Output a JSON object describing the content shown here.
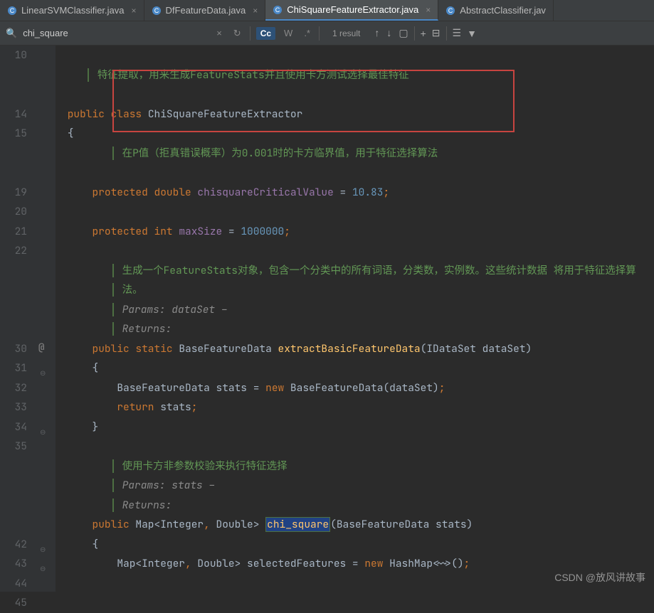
{
  "tabs": [
    {
      "name": "LinearSVMClassifier.java",
      "active": false,
      "icon": "#4a88c7"
    },
    {
      "name": "DfFeatureData.java",
      "active": false,
      "icon": "#4a88c7"
    },
    {
      "name": "ChiSquareFeatureExtractor.java",
      "active": true,
      "icon": "#4a88c7"
    },
    {
      "name": "AbstractClassifier.jav",
      "active": false,
      "icon": "#4a88c7"
    }
  ],
  "search": {
    "value": "chi_square",
    "cc": "Cc",
    "w": "W",
    "result": "1 result"
  },
  "lines": {
    "10": "10",
    "14": "14",
    "15": "15",
    "19": "19",
    "20": "20",
    "21": "21",
    "22": "22",
    "30": "30",
    "31": "31",
    "32": "32",
    "33": "33",
    "34": "34",
    "35": "35",
    "42": "42",
    "43": "43",
    "44": "44",
    "45": "45"
  },
  "code": {
    "cmt1": "特征提取，用来生成FeatureStats并且使用卡方测试选择最佳特征",
    "l14a": "public",
    "l14b": "class",
    "l14c": "ChiSquareFeatureExtractor",
    "l15": "{",
    "cmt2": "在P值（拒真错误概率）为0.001时的卡方临界值，用于特征选择算法",
    "l19a": "protected",
    "l19b": "double",
    "l19c": "chisquareCriticalValue",
    "l19d": " = ",
    "l19e": "10.83",
    "l19f": ";",
    "l21a": "protected",
    "l21b": "int",
    "l21c": "maxSize",
    "l21d": " = ",
    "l21e": "1000000",
    "l21f": ";",
    "cmt3a": "生成一个FeatureStats对象，包含一个分类中的所有词语，分类数，实例数。这些统计数据 将用于特征选择算",
    "cmt3b": "法。",
    "params": "Params: ",
    "dataset": "dataSet – ",
    "returns": "Returns:",
    "l30a": "public",
    "l30b": "static",
    "l30c": "BaseFeatureData",
    "l30d": "extractBasicFeatureData",
    "l30e": "(IDataSet dataSet)",
    "l31": "{",
    "l32a": "BaseFeatureData stats = ",
    "l32b": "new",
    "l32c": " BaseFeatureData(dataSet)",
    "l32d": ";",
    "l33a": "return",
    "l33b": " stats",
    "l33c": ";",
    "l34": "}",
    "cmt4": "使用卡方非参数校验来执行特征选择",
    "params2": "Params: ",
    "stats": "stats – ",
    "l42a": "public",
    "l42b": " Map<Integer",
    "l42c": ", ",
    "l42d": "Double> ",
    "l42e": "chi_square",
    "l42f": "(BaseFeatureData stats)",
    "l43": "{",
    "l44a": "Map<Integer",
    "l44b": ", ",
    "l44c": "Double> selectedFeatures = ",
    "l44d": "new",
    "l44e": " HashMap<~>()",
    "l44f": ";"
  },
  "at": "@",
  "watermark": "CSDN @放风讲故事"
}
